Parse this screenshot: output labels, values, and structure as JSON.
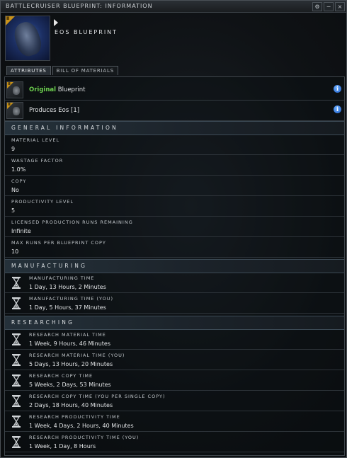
{
  "window": {
    "title": "BATTLECRUISER BLUEPRINT: INFORMATION",
    "controls": [
      "⚙",
      "−",
      "×"
    ]
  },
  "header": {
    "blueprint_name": "EOS BLUEPRINT",
    "tech_badge": "II"
  },
  "tabs": [
    {
      "label": "ATTRIBUTES",
      "active": true
    },
    {
      "label": "BILL OF MATERIALS",
      "active": false
    }
  ],
  "blueprint_rows": [
    {
      "highlight": "Original",
      "text": " Blueprint",
      "icon": "blueprint-icon"
    },
    {
      "highlight": "",
      "text": "Produces Eos [1]",
      "icon": "eos-ship-icon"
    }
  ],
  "sections": {
    "general": "GENERAL INFORMATION",
    "manufacturing": "MANUFACTURING",
    "researching": "RESEARCHING"
  },
  "general_attributes": [
    {
      "label": "MATERIAL LEVEL",
      "value": "9"
    },
    {
      "label": "WASTAGE FACTOR",
      "value": "1.0%"
    },
    {
      "label": "COPY",
      "value": "No"
    },
    {
      "label": "PRODUCTIVITY LEVEL",
      "value": "5"
    },
    {
      "label": "LICENSED PRODUCTION RUNS REMAINING",
      "value": "Infinite"
    },
    {
      "label": "MAX RUNS PER BLUEPRINT COPY",
      "value": "10"
    }
  ],
  "manufacturing_times": [
    {
      "label": "MANUFACTURING TIME",
      "value": "1 Day, 13 Hours, 2 Minutes"
    },
    {
      "label": "MANUFACTURING TIME (YOU)",
      "value": "1 Day, 5 Hours, 37 Minutes"
    }
  ],
  "research_times": [
    {
      "label": "RESEARCH MATERIAL TIME",
      "value": "1 Week, 9 Hours, 46 Minutes"
    },
    {
      "label": "RESEARCH MATERIAL TIME (YOU)",
      "value": "5 Days, 13 Hours, 20 Minutes"
    },
    {
      "label": "RESEARCH COPY TIME",
      "value": "5 Weeks, 2 Days, 53 Minutes"
    },
    {
      "label": "RESEARCH COPY TIME (YOU PER SINGLE COPY)",
      "value": "2 Days, 18 Hours, 40 Minutes"
    },
    {
      "label": "RESEARCH PRODUCTIVITY TIME",
      "value": "1 Week, 4 Days, 2 Hours, 40 Minutes"
    },
    {
      "label": "RESEARCH PRODUCTIVITY TIME (YOU)",
      "value": "1 Week, 1 Day, 8 Hours"
    }
  ],
  "colors": {
    "original_highlight": "#6ed14f",
    "tech_badge": "#c8921a",
    "info_icon": "#1d5fc9"
  }
}
